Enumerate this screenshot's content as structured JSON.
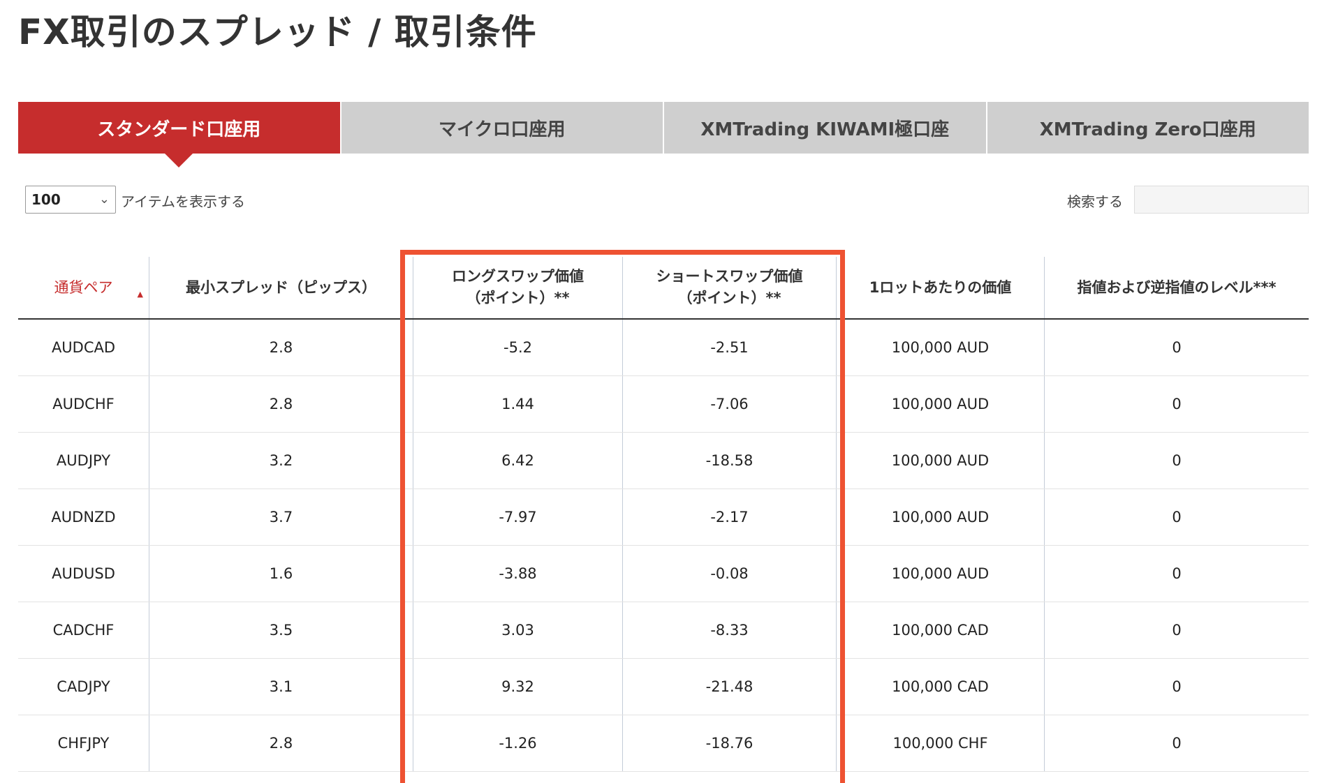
{
  "page": {
    "title": "FX取引のスプレッド / 取引条件"
  },
  "tabs": [
    {
      "label": "スタンダード口座用",
      "active": true
    },
    {
      "label": "マイクロ口座用",
      "active": false
    },
    {
      "label": "XMTrading KIWAMI極口座",
      "active": false
    },
    {
      "label": "XMTrading Zero口座用",
      "active": false
    }
  ],
  "controls": {
    "page_size_value": "100",
    "page_size_label": "アイテムを表示する",
    "search_label": "検索する",
    "search_value": ""
  },
  "table": {
    "headers": [
      {
        "label": "通貨ペア",
        "sorted": true
      },
      {
        "label": "最小スプレッド（ピップス）"
      },
      {
        "label_line1": "ロングスワップ価値",
        "label_line2": "（ポイント）**"
      },
      {
        "label_line1": "ショートスワップ価値",
        "label_line2": "（ポイント）**"
      },
      {
        "label": "1ロットあたりの価値"
      },
      {
        "label": "指値および逆指値のレベル***"
      }
    ],
    "rows": [
      [
        "AUDCAD",
        "2.8",
        "-5.2",
        "-2.51",
        "100,000 AUD",
        "0"
      ],
      [
        "AUDCHF",
        "2.8",
        "1.44",
        "-7.06",
        "100,000 AUD",
        "0"
      ],
      [
        "AUDJPY",
        "3.2",
        "6.42",
        "-18.58",
        "100,000 AUD",
        "0"
      ],
      [
        "AUDNZD",
        "3.7",
        "-7.97",
        "-2.17",
        "100,000 AUD",
        "0"
      ],
      [
        "AUDUSD",
        "1.6",
        "-3.88",
        "-0.08",
        "100,000 AUD",
        "0"
      ],
      [
        "CADCHF",
        "3.5",
        "3.03",
        "-8.33",
        "100,000 CAD",
        "0"
      ],
      [
        "CADJPY",
        "3.1",
        "9.32",
        "-21.48",
        "100,000 CAD",
        "0"
      ],
      [
        "CHFJPY",
        "2.8",
        "-1.26",
        "-18.76",
        "100,000 CHF",
        "0"
      ]
    ]
  },
  "icons": {
    "sort": "sort-ascending-icon",
    "dropdown": "chevron-down-icon"
  },
  "colors": {
    "accent": "#c62d2d",
    "highlight": "#ee5232",
    "tab_inactive": "#cfcfcf"
  }
}
